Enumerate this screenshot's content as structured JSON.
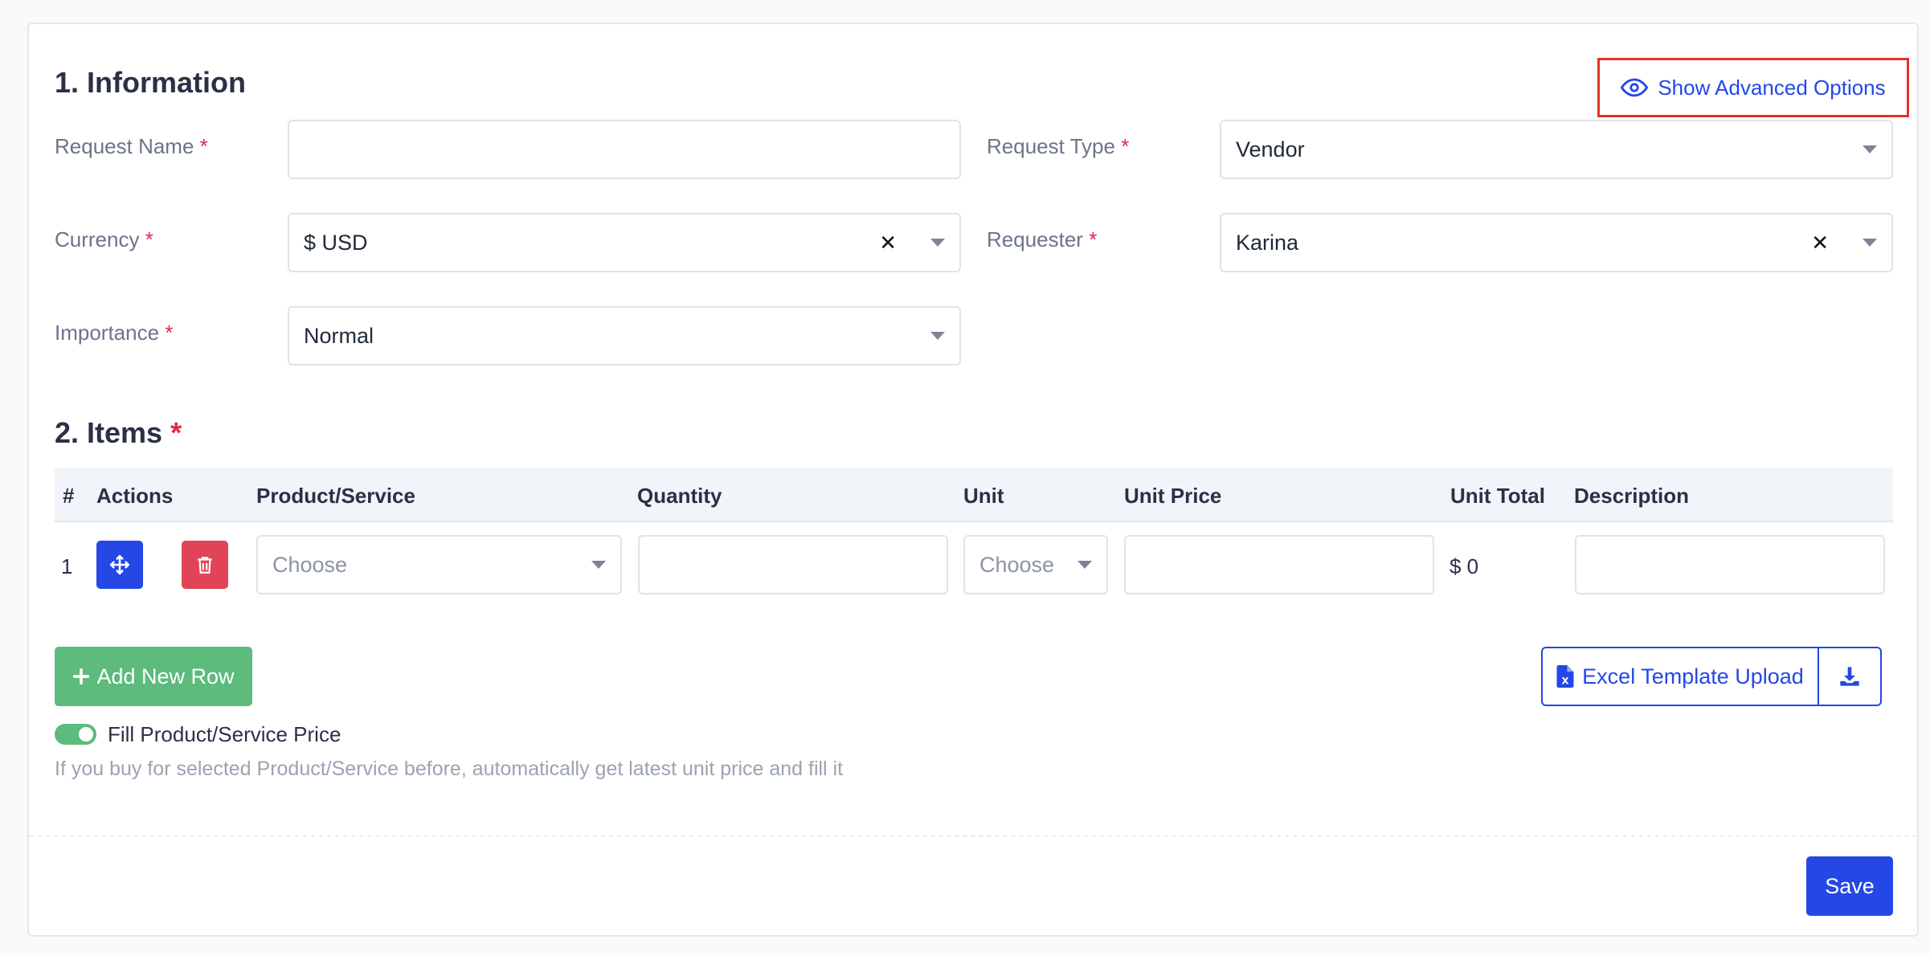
{
  "information": {
    "title": "1. Information",
    "advanced_options_label": "Show Advanced Options",
    "request_name": {
      "label": "Request Name",
      "value": ""
    },
    "request_type": {
      "label": "Request Type",
      "value": "Vendor"
    },
    "currency": {
      "label": "Currency",
      "value": "$ USD"
    },
    "requester": {
      "label": "Requester",
      "value": "Karina"
    },
    "importance": {
      "label": "Importance",
      "value": "Normal"
    },
    "required_mark": "*"
  },
  "items": {
    "title": "2. Items",
    "columns": [
      "#",
      "Actions",
      "Product/Service",
      "Quantity",
      "Unit",
      "Unit Price",
      "Unit Total",
      "Description"
    ],
    "rows": [
      {
        "num": "1",
        "product_placeholder": "Choose",
        "quantity": "",
        "unit_placeholder": "Choose",
        "unit_price": "",
        "unit_total": "$ 0",
        "description": ""
      }
    ],
    "add_row_label": "Add New Row",
    "excel_upload_label": "Excel Template Upload",
    "fill_price_label": "Fill Product/Service Price",
    "fill_price_enabled": true,
    "fill_price_hint": "If you buy for selected Product/Service before, automatically get latest unit price and fill it"
  },
  "footer": {
    "save_label": "Save"
  },
  "colors": {
    "primary": "#2447e6",
    "success": "#5cbb7d",
    "danger": "#e04456",
    "highlight": "#e53226"
  }
}
